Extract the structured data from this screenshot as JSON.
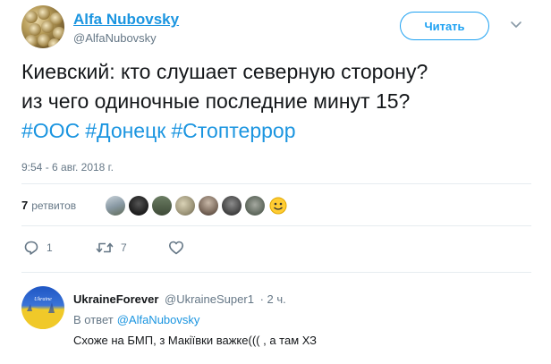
{
  "tweet": {
    "author_name": "Alfa Nubovsky",
    "author_handle": "@AlfaNubovsky",
    "follow_label": "Читать",
    "text_lines": [
      "Киевский: кто слушает северную сторону?",
      "из чего одиночные последние минут 15?"
    ],
    "hashtags": [
      "#ООС",
      "#Донецк",
      "#Стоптеррор"
    ],
    "timestamp": "9:54 - 6 авг. 2018 г."
  },
  "stats": {
    "retweet_count": "7",
    "retweet_label": "ретвитов",
    "retweeter_avatars": [
      "retweeter-1",
      "retweeter-2",
      "retweeter-3",
      "retweeter-4",
      "retweeter-5",
      "retweeter-6",
      "retweeter-7"
    ]
  },
  "actions": {
    "reply_icon": "reply-icon",
    "reply_count": "1",
    "retweet_icon": "retweet-icon",
    "retweet_count": "7",
    "like_icon": "heart-icon"
  },
  "reply": {
    "author_name": "UkraineForever",
    "author_handle": "@UkraineSuper1",
    "time": "· 2 ч.",
    "context_prefix": "В ответ",
    "context_link": "@AlfaNubovsky",
    "text": "Схоже на БМП, з Макіївки важке((( , а там ХЗ"
  },
  "colors": {
    "accent": "#1da1f2",
    "link": "#1b95e0",
    "muted": "#657786",
    "text": "#14171a"
  }
}
